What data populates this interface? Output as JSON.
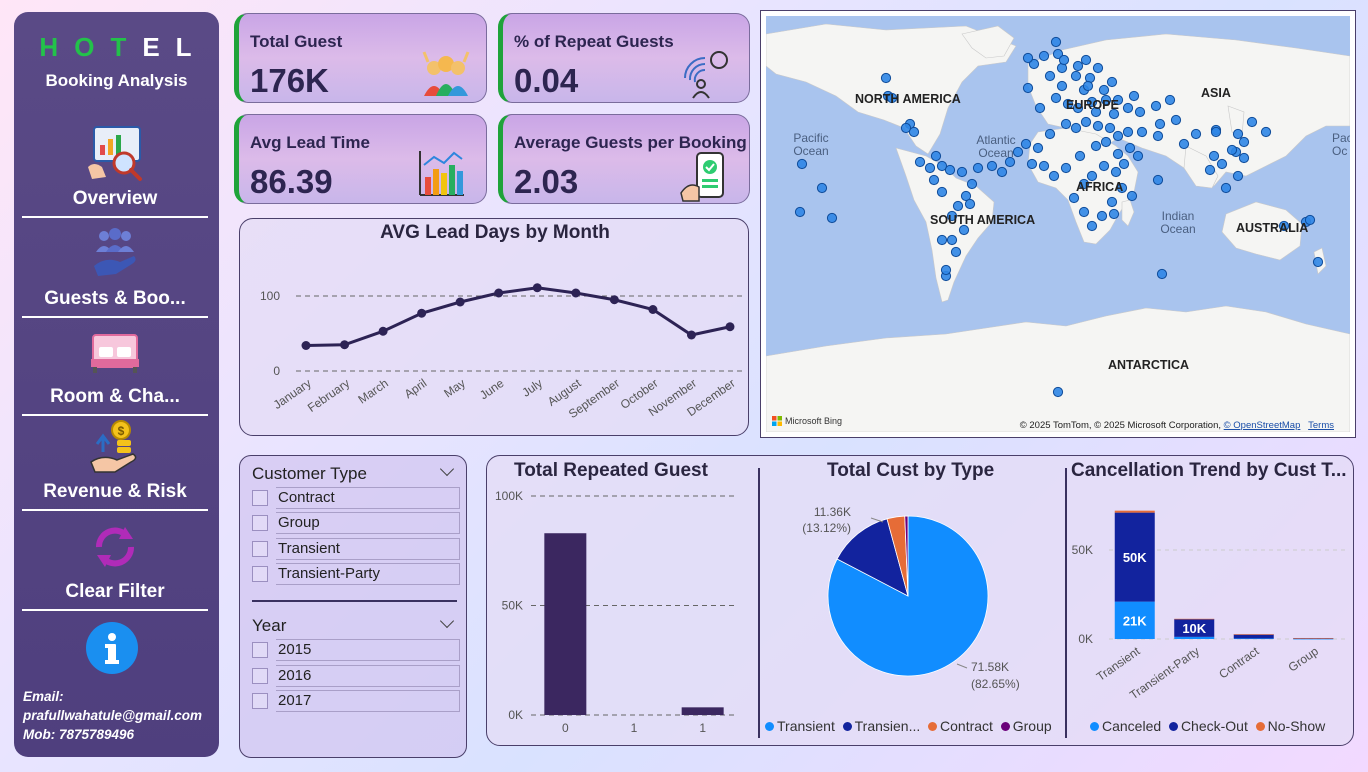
{
  "sidebar": {
    "brand_letters": [
      "H",
      "O",
      "T",
      "E",
      "L"
    ],
    "subtitle": "Booking Analysis",
    "nav": [
      {
        "label": "Overview",
        "icon": "presentation-icon"
      },
      {
        "label": "Guests & Boo...",
        "icon": "guests-icon"
      },
      {
        "label": "Room & Cha...",
        "icon": "room-icon"
      },
      {
        "label": "Revenue & Risk",
        "icon": "revenue-icon"
      },
      {
        "label": "Clear Filter",
        "icon": "refresh-icon"
      }
    ],
    "info_icon": "info-icon",
    "contact": {
      "email_label": "Email:",
      "email": "prafullwahatule@gmail.com",
      "mobile": "Mob: 7875789496"
    }
  },
  "kpis": [
    {
      "title": "Total Guest",
      "value": "176K",
      "icon": "crowd-icon"
    },
    {
      "title": "% of Repeat Guests",
      "value": "0.04",
      "icon": "repeat-user-icon"
    },
    {
      "title": "Avg Lead Time",
      "value": "86.39",
      "icon": "bar-trend-icon"
    },
    {
      "title": "Average Guests per Booking",
      "value": "2.03",
      "icon": "phone-check-icon"
    }
  ],
  "colors": {
    "accent_green": "#1fa33a",
    "line": "#2d2355",
    "transient": "#118dff",
    "transient_party": "#12239e",
    "contract": "#e66c37",
    "group": "#6b007b",
    "bar_purple": "#3b2760"
  },
  "chart_data": [
    {
      "type": "line",
      "title": "AVG Lead Days by Month",
      "categories": [
        "January",
        "February",
        "March",
        "April",
        "May",
        "June",
        "July",
        "August",
        "September",
        "October",
        "November",
        "December"
      ],
      "values": [
        34,
        35,
        53,
        77,
        92,
        104,
        111,
        104,
        95,
        82,
        48,
        59
      ],
      "y_ticks": [
        "0",
        "100"
      ],
      "ylim": [
        0,
        100
      ],
      "grid": "dashed"
    },
    {
      "type": "bar",
      "title": "Total Repeated Guest",
      "categories": [
        "0",
        "1",
        "1"
      ],
      "values": [
        83000,
        0,
        3500
      ],
      "y_ticks": [
        "0K",
        "50K",
        "100K"
      ],
      "ylim": [
        0,
        100000
      ]
    },
    {
      "type": "pie",
      "title": "Total Cust by Type",
      "slices": [
        {
          "name": "Transient",
          "value": 71580,
          "percent": 82.65
        },
        {
          "name": "Transien...",
          "value": 11360,
          "percent": 13.12
        },
        {
          "name": "Contract",
          "value": 3100,
          "percent": 3.58
        },
        {
          "name": "Group",
          "value": 560,
          "percent": 0.65
        }
      ],
      "data_labels": [
        {
          "value": "11.36K",
          "percent": "(13.12%)"
        },
        {
          "value": "71.58K",
          "percent": "(82.65%)"
        }
      ],
      "legend": [
        "Transient",
        "Transien...",
        "Contract",
        "Group"
      ]
    },
    {
      "type": "bar",
      "stacked": true,
      "title": "Cancellation Trend by Cust T...",
      "categories": [
        "Transient",
        "Transient-Party",
        "Contract",
        "Group"
      ],
      "series": [
        {
          "name": "Canceled",
          "values": [
            21000,
            1200,
            300,
            100
          ]
        },
        {
          "name": "Check-Out",
          "values": [
            50000,
            10000,
            2300,
            450
          ]
        },
        {
          "name": "No-Show",
          "values": [
            1100,
            150,
            50,
            20
          ]
        }
      ],
      "data_labels": [
        "21K",
        "50K",
        "10K"
      ],
      "y_ticks": [
        "0K",
        "50K"
      ],
      "ylim": [
        0,
        75000
      ]
    }
  ],
  "map": {
    "labels": [
      "NORTH AMERICA",
      "Pacific Ocean",
      "Atlantic Ocean",
      "EUROPE",
      "ASIA",
      "AFRICA",
      "SOUTH AMERICA",
      "Indian Ocean",
      "AUSTRALIA",
      "ANTARCTICA",
      "Pac Oc"
    ],
    "ms_logo": "Microsoft Bing",
    "copyright": "© 2025 TomTom, © 2025 Microsoft Corporation,",
    "osm": "© OpenStreetMap",
    "terms": "Terms"
  },
  "slicers": {
    "customer_type": {
      "title": "Customer Type",
      "options": [
        "Contract",
        "Group",
        "Transient",
        "Transient-Party"
      ]
    },
    "year": {
      "title": "Year",
      "options": [
        "2015",
        "2016",
        "2017"
      ]
    }
  },
  "legends": {
    "pie": [
      "Transient",
      "Transien...",
      "Contract",
      "Group"
    ],
    "stack": [
      "Canceled",
      "Check-Out",
      "No-Show"
    ]
  }
}
